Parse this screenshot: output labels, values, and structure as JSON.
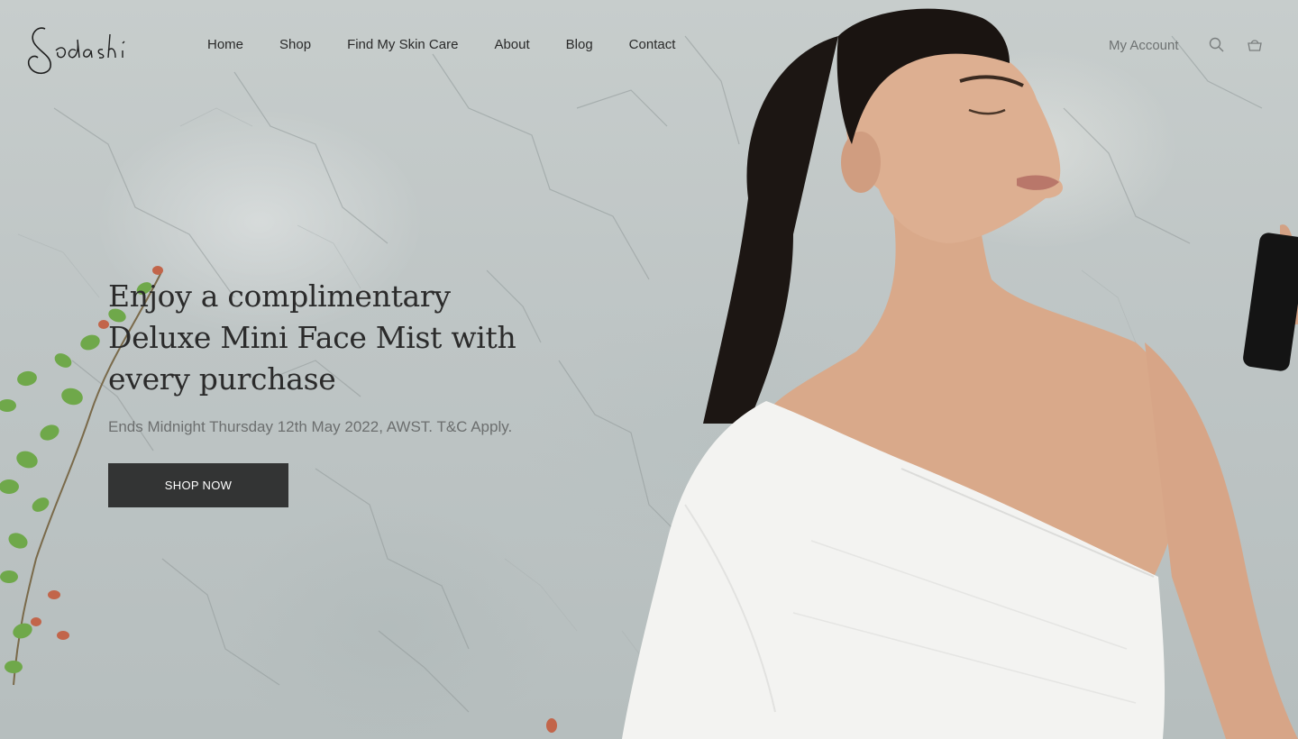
{
  "brand": {
    "logo_text": "Sodashi"
  },
  "nav": {
    "items": [
      {
        "label": "Home"
      },
      {
        "label": "Shop"
      },
      {
        "label": "Find My Skin Care"
      },
      {
        "label": "About"
      },
      {
        "label": "Blog"
      },
      {
        "label": "Contact"
      }
    ]
  },
  "account": {
    "label": "My Account",
    "search_icon": "search-icon",
    "cart_icon": "basket-icon"
  },
  "hero": {
    "title": "Enjoy a complimentary Deluxe Mini Face Mist with every purchase",
    "subtitle": "Ends Midnight Thursday 12th May 2022, AWST. T&C Apply.",
    "button_label": "Shop Now"
  },
  "colors": {
    "text_dark": "#2b2b2b",
    "text_muted": "#6c6f6f",
    "button_bg": "#333434",
    "button_text": "#ffffff",
    "wall": "#c0c7c7"
  }
}
